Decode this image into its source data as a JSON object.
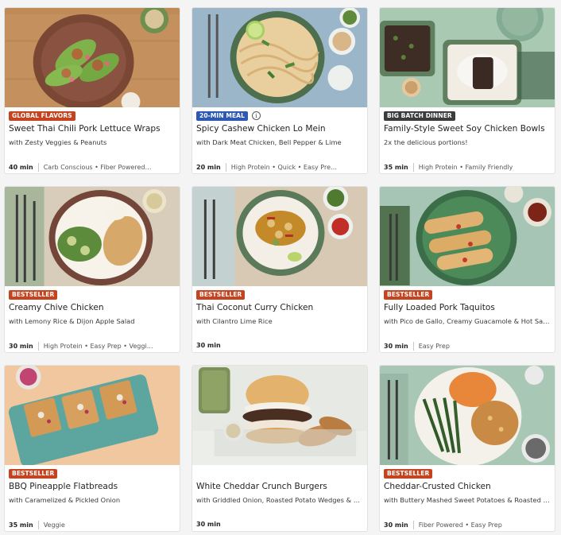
{
  "cards": [
    {
      "badge": "GLOBAL FLAVORS",
      "title": "Sweet Thai Chili Pork Lettuce Wraps",
      "subtitle": "with Zesty Veggies & Peanuts",
      "time": "40 min",
      "tags": "Carb Conscious • Fiber Powered…"
    },
    {
      "badge": "20-MIN MEAL",
      "info_icon": "i",
      "title": "Spicy Cashew Chicken Lo Mein",
      "subtitle": "with Dark Meat Chicken, Bell Pepper & Lime",
      "time": "20 min",
      "tags": "High Protein • Quick • Easy Pre…"
    },
    {
      "badge": "BIG BATCH DINNER",
      "title": "Family-Style Sweet Soy Chicken Bowls",
      "subtitle": "2x the delicious portions!",
      "time": "35 min",
      "tags": "High Protein • Family Friendly"
    },
    {
      "badge": "BESTSELLER",
      "title": "Creamy Chive Chicken",
      "subtitle": "with Lemony Rice & Dijon Apple Salad",
      "time": "30 min",
      "tags": "High Protein • Easy Prep • Veggi…"
    },
    {
      "badge": "BESTSELLER",
      "title": "Thai Coconut Curry Chicken",
      "subtitle": "with Cilantro Lime Rice",
      "time": "30 min",
      "tags": ""
    },
    {
      "badge": "BESTSELLER",
      "title": "Fully Loaded Pork Taquitos",
      "subtitle": "with Pico de Gallo, Creamy Guacamole & Hot Sauce",
      "time": "30 min",
      "tags": "Easy Prep"
    },
    {
      "badge": "BESTSELLER",
      "title": "BBQ Pineapple Flatbreads",
      "subtitle": "with Caramelized & Pickled Onion",
      "time": "35 min",
      "tags": "Veggie"
    },
    {
      "badge": "",
      "title": "White Cheddar Crunch Burgers",
      "subtitle": "with Griddled Onion, Roasted Potato Wedges & Smo…",
      "time": "30 min",
      "tags": ""
    },
    {
      "badge": "BESTSELLER",
      "title": "Cheddar-Crusted Chicken",
      "subtitle": "with Buttery Mashed Sweet Potatoes & Roasted Gre…",
      "time": "30 min",
      "tags": "Fiber Powered • Easy Prep"
    }
  ],
  "colors": {
    "badge_orange": "#c6431f",
    "badge_blue": "#2d58b4",
    "badge_dark": "#3c3c3c"
  }
}
